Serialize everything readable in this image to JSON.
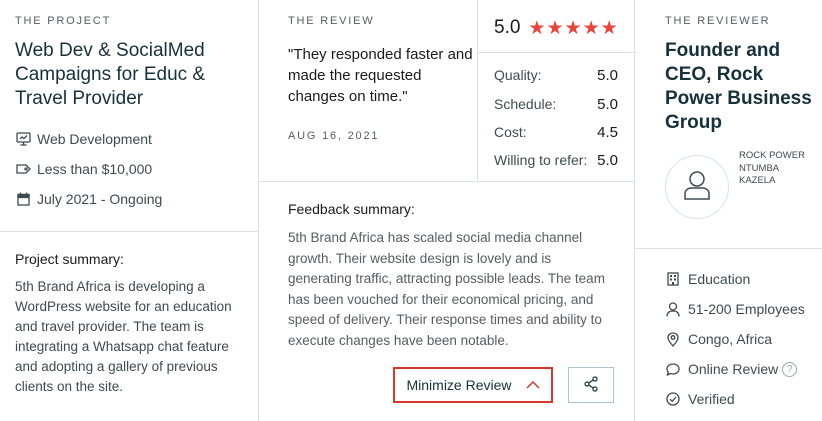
{
  "project": {
    "section_label": "THE PROJECT",
    "title": "Web Dev & SocialMed Campaigns for Educ & Travel Provider",
    "service": "Web Development",
    "budget": "Less than $10,000",
    "timeline": "July 2021 - Ongoing",
    "summary_label": "Project summary:",
    "summary_text": "5th Brand Africa is developing a WordPress website for an education and travel provider. The team is integrating a Whatsapp chat feature and adopting a gallery of previous clients on the site."
  },
  "review": {
    "section_label": "THE REVIEW",
    "quote": "\"They responded faster and made the requested changes on time.\"",
    "date": "AUG 16, 2021",
    "overall_rating": "5.0",
    "stars": 5,
    "star_color": "#e8453c",
    "ratings": [
      {
        "label": "Quality:",
        "value": "5.0"
      },
      {
        "label": "Schedule:",
        "value": "5.0"
      },
      {
        "label": "Cost:",
        "value": "4.5"
      },
      {
        "label": "Willing to refer:",
        "value": "5.0"
      }
    ],
    "feedback_label": "Feedback summary:",
    "feedback_text": "5th Brand Africa has scaled social media channel growth. Their website design is lovely and is generating traffic, attracting possible leads. The team has been vouched for their economical pricing, and speed of delivery. Their response times and ability to execute changes have been notable.",
    "minimize_label": "Minimize Review",
    "accent_color": "#d8362c"
  },
  "reviewer": {
    "section_label": "THE REVIEWER",
    "title": "Founder and CEO, Rock Power Business Group",
    "name": "ROCK POWER NTUMBA KAZELA",
    "industry": "Education",
    "size": "51-200 Employees",
    "location": "Congo, Africa",
    "review_type": "Online Review",
    "help_glyph": "?",
    "status": "Verified"
  }
}
